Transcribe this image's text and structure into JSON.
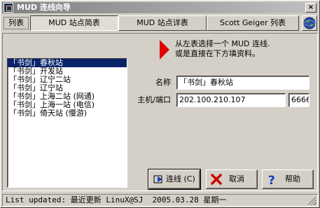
{
  "window": {
    "title": "MUD 连线向导",
    "close_label": "×"
  },
  "tabs": {
    "list_label": "列表",
    "items": [
      {
        "label": "MUD 站点简表",
        "active": true
      },
      {
        "label": "MUD 站点详表",
        "active": false
      },
      {
        "label": "Scott Geiger 列表",
        "active": false
      }
    ],
    "globe_icon": "globe-icon"
  },
  "site_list": {
    "items": [
      {
        "label": "「书剑」春秋站",
        "selected": true
      },
      {
        "label": "「书剑」开发站",
        "selected": false
      },
      {
        "label": "「书剑」辽宁二站",
        "selected": false
      },
      {
        "label": "「书剑」辽宁站",
        "selected": false
      },
      {
        "label": "「书剑」上海二站 (网通)",
        "selected": false
      },
      {
        "label": "「书剑」上海一站 (电信)",
        "selected": false
      },
      {
        "label": "「书剑」倚天站 (慢游)",
        "selected": false
      }
    ]
  },
  "hint": {
    "line1": "从左表选择一个 MUD 连线.",
    "line2": "或是直接在下方填资料。",
    "arrow_color": "#e00000"
  },
  "form": {
    "name_label": "名称",
    "name_value": "「书剑」春秋站",
    "host_label": "主机/端口",
    "host_value": "202.100.210.107",
    "port_value": "6666"
  },
  "buttons": {
    "connect": "连线 (C)",
    "cancel": "取消",
    "help": "帮助"
  },
  "status": {
    "text": "List updated: 最近更新 LinuX@SJ  2005.03.28 星期一"
  },
  "colors": {
    "selection": "#0a246a",
    "face": "#d4d0c8"
  }
}
